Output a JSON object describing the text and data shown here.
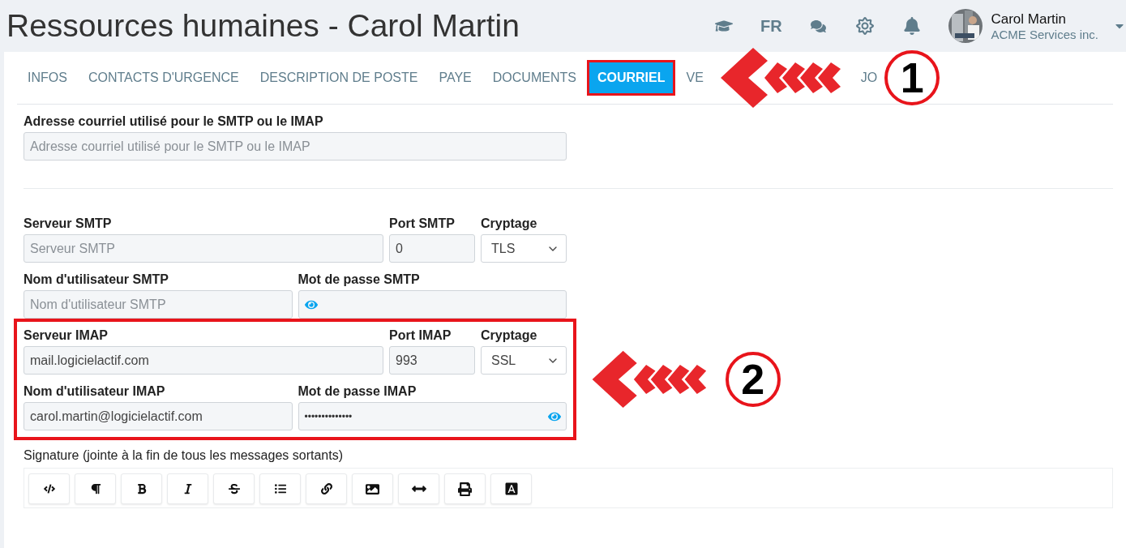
{
  "header": {
    "title": "Ressources humaines - Carol Martin",
    "language": "FR",
    "user": {
      "name": "Carol Martin",
      "company": "ACME Services inc."
    }
  },
  "tabs": [
    {
      "label": "INFOS",
      "selected": false,
      "highlighted": false
    },
    {
      "label": "CONTACTS D'URGENCE",
      "selected": false,
      "highlighted": false
    },
    {
      "label": "DESCRIPTION DE POSTE",
      "selected": false,
      "highlighted": false
    },
    {
      "label": "PAYE",
      "selected": false,
      "highlighted": false
    },
    {
      "label": "DOCUMENTS",
      "selected": false,
      "highlighted": false
    },
    {
      "label": "COURRIEL",
      "selected": true,
      "highlighted": true
    },
    {
      "label": "VE",
      "selected": false,
      "highlighted": false
    },
    {
      "label": "JO",
      "selected": false,
      "highlighted": false
    }
  ],
  "tab_marker": {
    "number": "1"
  },
  "sections": [
    {
      "highlighted": false,
      "rows": [
        [
          {
            "kind": "text",
            "label": "Adresse courriel utilisé pour le SMTP ou le IMAP",
            "placeholder": "Adresse courriel utilisé pour le SMTP ou le IMAP"
          }
        ]
      ]
    },
    {
      "highlighted": false,
      "rows": [
        [
          {
            "kind": "text",
            "label": "Serveur SMTP",
            "placeholder": "Serveur SMTP"
          },
          {
            "kind": "text",
            "label": "Port SMTP",
            "value": "0"
          },
          {
            "kind": "select",
            "label": "Cryptage",
            "value": "TLS"
          }
        ],
        [
          {
            "kind": "text",
            "label": "Nom d'utilisateur SMTP",
            "placeholder": "Nom d'utilisateur SMTP"
          },
          {
            "kind": "password",
            "label": "Mot de passe SMTP"
          }
        ]
      ]
    },
    {
      "highlighted": true,
      "marker": {
        "number": "2"
      },
      "rows": [
        [
          {
            "kind": "text",
            "label": "Serveur IMAP",
            "value": "mail.logicielactif.com"
          },
          {
            "kind": "text",
            "label": "Port IMAP",
            "value": "993"
          },
          {
            "kind": "select",
            "label": "Cryptage",
            "value": "SSL"
          }
        ],
        [
          {
            "kind": "text",
            "label": "Nom d'utilisateur IMAP",
            "value": "carol.martin@logicielactif.com"
          },
          {
            "kind": "password",
            "label": "Mot de passe IMAP",
            "value": "••••••••••••••"
          }
        ]
      ]
    }
  ],
  "signature": {
    "label": "Signature (jointe à la fin de tous les messages sortants)"
  }
}
